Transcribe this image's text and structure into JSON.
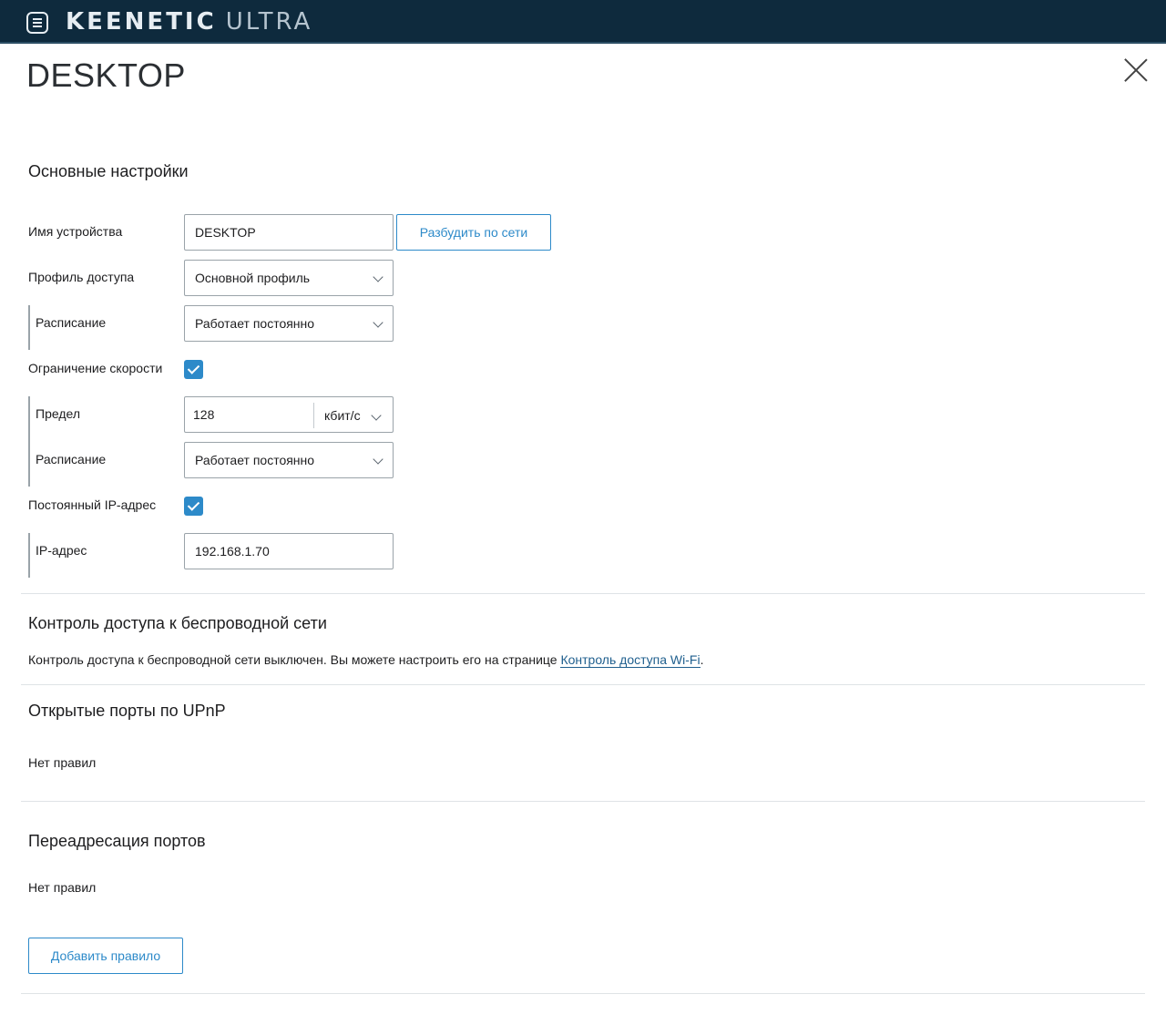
{
  "header": {
    "brand": "KEENETIC",
    "model": "ULTRA"
  },
  "page": {
    "title": "DESKTOP"
  },
  "basic": {
    "section_title": "Основные настройки",
    "device_name_label": "Имя устройства",
    "device_name_value": "DESKTOP",
    "wake_button": "Разбудить по сети",
    "access_profile_label": "Профиль доступа",
    "access_profile_value": "Основной профиль",
    "schedule_label": "Расписание",
    "schedule_value": "Работает постоянно",
    "speed_limit_label": "Ограничение скорости",
    "speed_limit_checked": true,
    "limit_label": "Предел",
    "limit_value": "128",
    "limit_unit": "кбит/с",
    "speed_schedule_label": "Расписание",
    "speed_schedule_value": "Работает постоянно",
    "static_ip_label": "Постоянный IP-адрес",
    "static_ip_checked": true,
    "ip_label": "IP-адрес",
    "ip_value": "192.168.1.70"
  },
  "wireless": {
    "section_title": "Контроль доступа к беспроводной сети",
    "text": "Контроль доступа к беспроводной сети выключен. Вы можете настроить его на странице ",
    "link": "Контроль доступа Wi-Fi",
    "suffix": "."
  },
  "upnp": {
    "section_title": "Открытые порты по UPnP",
    "empty": "Нет правил"
  },
  "forwarding": {
    "section_title": "Переадресация портов",
    "empty": "Нет правил",
    "add_button": "Добавить правило"
  },
  "colors": {
    "header_bg": "#0e2a3d",
    "accent": "#2d8ac9",
    "link": "#1f5f8e"
  }
}
